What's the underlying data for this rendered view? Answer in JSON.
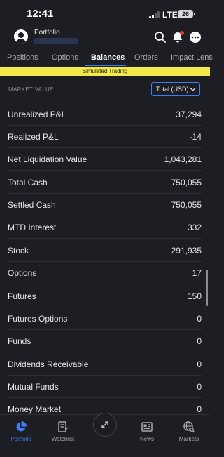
{
  "status_bar": {
    "time": "12:41",
    "carrier": "LTE",
    "battery": "26"
  },
  "header": {
    "portfolio_label": "Portfolio",
    "icons": [
      "user-icon",
      "search-icon",
      "bell-icon",
      "more-icon"
    ]
  },
  "tabs": [
    {
      "label": "Positions"
    },
    {
      "label": "Options"
    },
    {
      "label": "Balances"
    },
    {
      "label": "Orders"
    },
    {
      "label": "Impact Lens"
    }
  ],
  "active_tab": "Balances",
  "banner": "Simulated Trading",
  "market_value": {
    "label": "MARKET VALUE",
    "currency_selected": "Total (USD)"
  },
  "rows": [
    {
      "label": "Unrealized P&L",
      "value": "37,294"
    },
    {
      "label": "Realized P&L",
      "value": "-14"
    },
    {
      "label": "Net Liquidation Value",
      "value": "1,043,281"
    },
    {
      "label": "Total Cash",
      "value": "750,055"
    },
    {
      "label": "Settled Cash",
      "value": "750,055"
    },
    {
      "label": "MTD Interest",
      "value": "332"
    },
    {
      "label": "Stock",
      "value": "291,935"
    },
    {
      "label": "Options",
      "value": "17"
    },
    {
      "label": "Futures",
      "value": "150"
    },
    {
      "label": "Futures Options",
      "value": "0"
    },
    {
      "label": "Funds",
      "value": "0"
    },
    {
      "label": "Dividends Receivable",
      "value": "0"
    },
    {
      "label": "Mutual Funds",
      "value": "0"
    },
    {
      "label": "Money Market",
      "value": "0"
    }
  ],
  "bottom_nav": [
    {
      "label": "Portfolio",
      "icon": "pie-chart-icon"
    },
    {
      "label": "Watchlist",
      "icon": "watchlist-icon"
    },
    {
      "label": "News",
      "icon": "news-icon"
    },
    {
      "label": "Markets",
      "icon": "globe-search-icon"
    }
  ],
  "colors": {
    "accent": "#3b7df2",
    "background": "#1d1e23",
    "banner": "#f3ea4a",
    "notification": "#e53935"
  }
}
